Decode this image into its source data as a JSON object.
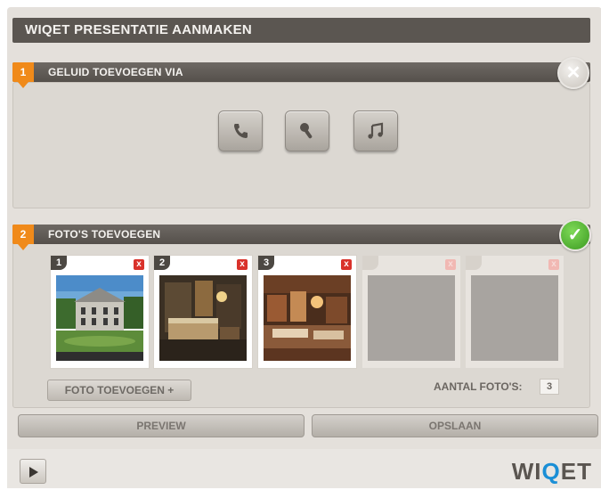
{
  "app": {
    "title": "WIQET PRESENTATIE AANMAKEN"
  },
  "section1": {
    "step": "1",
    "label": "GELUID TOEVOEGEN VIA",
    "close_icon": "close-icon",
    "buttons": [
      {
        "icon": "phone-icon"
      },
      {
        "icon": "microphone-icon"
      },
      {
        "icon": "music-note-icon"
      }
    ]
  },
  "section2": {
    "step": "2",
    "label": "FOTO'S TOEVOEGEN",
    "status_icon": "check-icon",
    "photos": [
      {
        "num": "1",
        "filled": true,
        "image": "castle-photo"
      },
      {
        "num": "2",
        "filled": true,
        "image": "bedroom-photo"
      },
      {
        "num": "3",
        "filled": true,
        "image": "restaurant-photo"
      },
      {
        "num": "",
        "filled": false
      },
      {
        "num": "",
        "filled": false
      }
    ],
    "delete_glyph": "x",
    "add_button_label": "FOTO TOEVOEGEN +",
    "count_label": "AANTAL FOTO'S:",
    "count_value": "3"
  },
  "actions": {
    "preview_label": "PREVIEW",
    "save_label": "OPSLAAN"
  },
  "footer": {
    "logo_prefix": "WI",
    "logo_q": "Q",
    "logo_suffix": "ET",
    "play_icon": "play-icon"
  },
  "colors": {
    "accent": "#f08a1a",
    "check": "#4caf2c",
    "delete": "#d9322b",
    "logo_q": "#1b8fd6"
  }
}
